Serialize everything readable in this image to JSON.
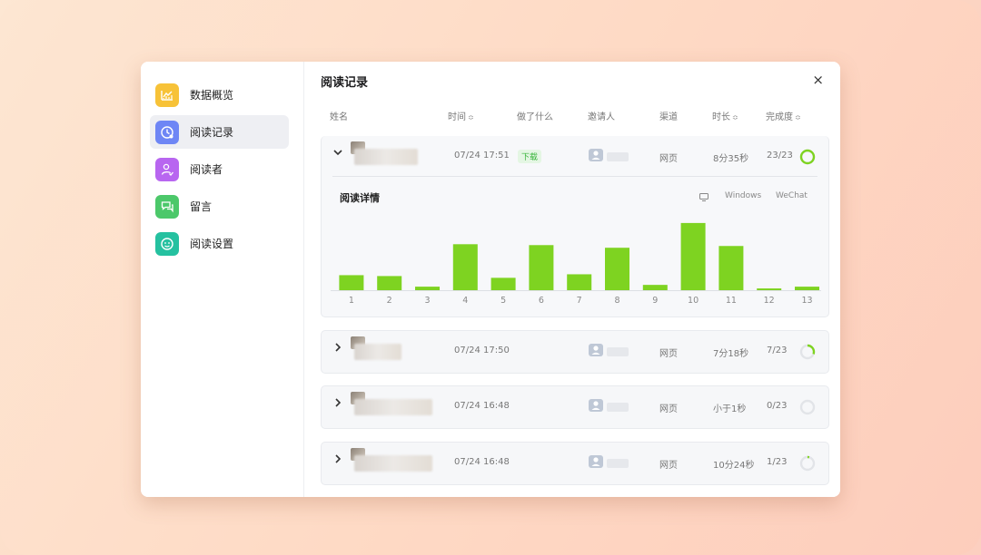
{
  "sidebar": {
    "items": [
      {
        "label": "数据概览",
        "icon": "chart-icon",
        "color": "#f7c238"
      },
      {
        "label": "阅读记录",
        "icon": "clock-icon",
        "color": "#6e86f5"
      },
      {
        "label": "阅读者",
        "icon": "user-check-icon",
        "color": "#b866f0"
      },
      {
        "label": "留言",
        "icon": "comment-icon",
        "color": "#4cc86a"
      },
      {
        "label": "阅读设置",
        "icon": "smile-settings-icon",
        "color": "#25c1a0"
      }
    ],
    "active_index": 1
  },
  "header": {
    "title": "阅读记录",
    "close": "×"
  },
  "table": {
    "columns": [
      {
        "label": "姓名",
        "sortable": false
      },
      {
        "label": "时间",
        "sortable": true
      },
      {
        "label": "做了什么",
        "sortable": false
      },
      {
        "label": "邀请人",
        "sortable": false
      },
      {
        "label": "渠道",
        "sortable": false
      },
      {
        "label": "时长",
        "sortable": true
      },
      {
        "label": "完成度",
        "sortable": true
      }
    ],
    "sort_glyph": "≎",
    "rows": [
      {
        "expanded": true,
        "time": "07/24 17:51",
        "action": "下载",
        "channel": "网页",
        "duration": "8分35秒",
        "progress": "23/23",
        "fraction": 1.0
      },
      {
        "expanded": false,
        "time": "07/24 17:50",
        "action": "",
        "channel": "网页",
        "duration": "7分18秒",
        "progress": "7/23",
        "fraction": 0.304
      },
      {
        "expanded": false,
        "time": "07/24 16:48",
        "action": "",
        "channel": "网页",
        "duration": "小于1秒",
        "progress": "0/23",
        "fraction": 0.0
      },
      {
        "expanded": false,
        "time": "07/24 16:48",
        "action": "",
        "channel": "网页",
        "duration": "10分24秒",
        "progress": "1/23",
        "fraction": 0.043
      }
    ]
  },
  "detail": {
    "title": "阅读详情",
    "legend": [
      "Windows",
      "WeChat"
    ],
    "bar_color": "#7ed321"
  },
  "chart_data": {
    "type": "bar",
    "categories": [
      "1",
      "2",
      "3",
      "4",
      "5",
      "6",
      "7",
      "8",
      "9",
      "10",
      "11",
      "12",
      "13"
    ],
    "values": [
      17,
      16,
      4,
      52,
      14,
      51,
      18,
      48,
      6,
      76,
      50,
      2,
      4
    ],
    "ylim": [
      0,
      80
    ],
    "grid": false
  },
  "colors": {
    "accent": "#7ed321",
    "ring_track": "#e2e4e8"
  }
}
